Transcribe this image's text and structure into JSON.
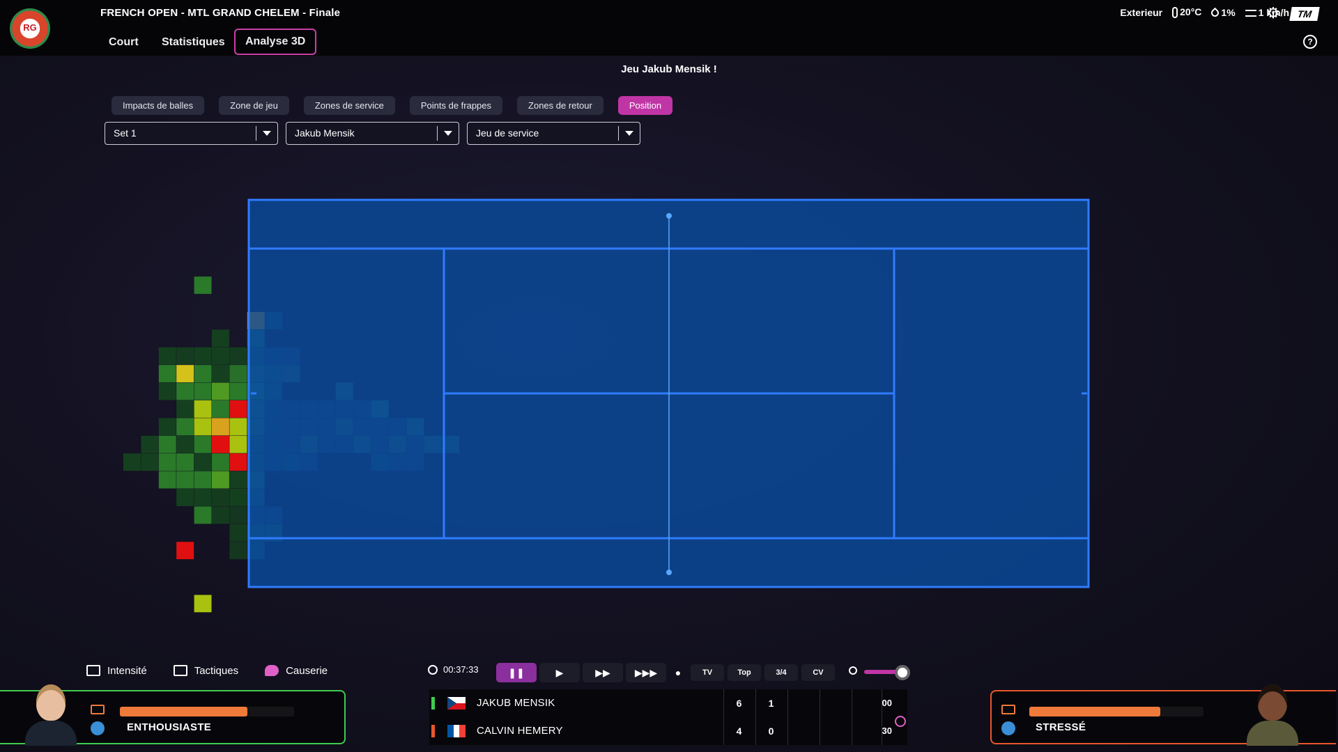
{
  "header": {
    "match_title": "FRENCH OPEN - MTL GRAND CHELEM - Finale",
    "tabs": [
      {
        "label": "Court",
        "active": false
      },
      {
        "label": "Statistiques",
        "active": false
      },
      {
        "label": "Analyse 3D",
        "active": true
      }
    ],
    "weather": {
      "location": "Exterieur",
      "temperature": "20°C",
      "humidity": "1%",
      "wind": "1 km/h"
    },
    "brand_logo": "TM"
  },
  "game_label": "Jeu Jakub Mensik !",
  "filters": [
    {
      "label": "Impacts de balles",
      "active": false
    },
    {
      "label": "Zone de jeu",
      "active": false
    },
    {
      "label": "Zones de service",
      "active": false
    },
    {
      "label": "Points de frappes",
      "active": false
    },
    {
      "label": "Zones de retour",
      "active": false
    },
    {
      "label": "Position",
      "active": true
    }
  ],
  "selects": {
    "set": "Set 1",
    "player": "Jakub Mensik",
    "game_type": "Jeu de service"
  },
  "colors": {
    "accent": "#c035a5",
    "court": "#0a4a9c",
    "court_lines": "#2f7cff",
    "energy": "#f07a3a",
    "home_border": "#3fcc4f",
    "away_border": "#e8572b"
  },
  "position_heatmap": {
    "scale": [
      "dark-green",
      "green",
      "yellow-green",
      "yellow",
      "orange",
      "red",
      "teal"
    ]
  },
  "bottom_actions": [
    {
      "label": "Intensité",
      "icon": "intensity-icon"
    },
    {
      "label": "Tactiques",
      "icon": "tactics-icon"
    },
    {
      "label": "Causerie",
      "icon": "chat-icon"
    }
  ],
  "players": {
    "home": {
      "mood": "ENTHOUSIASTE",
      "energy": 0.73
    },
    "away": {
      "mood": "STRESSÉ",
      "energy": 0.75
    }
  },
  "playback": {
    "time": "00:37:33",
    "controls": [
      {
        "icon": "pause-icon",
        "glyph": "❚❚",
        "active": true
      },
      {
        "icon": "play-icon",
        "glyph": "▶",
        "active": false
      },
      {
        "icon": "fast-forward-icon",
        "glyph": "▶▶",
        "active": false
      },
      {
        "icon": "fastest-forward-icon",
        "glyph": "▶▶▶",
        "active": false
      }
    ],
    "views": [
      "TV",
      "Top",
      "3/4",
      "CV"
    ],
    "zoom": 0.8
  },
  "scoreboard": [
    {
      "name": "JAKUB MENSIK",
      "flag": "czech",
      "marker": "#3fcc4f",
      "sets": [
        "6",
        "1",
        "",
        "",
        ""
      ],
      "points": "00"
    },
    {
      "name": "CALVIN HEMERY",
      "flag": "france",
      "marker": "#e8572b",
      "sets": [
        "4",
        "0",
        "",
        "",
        ""
      ],
      "points": "30"
    }
  ]
}
